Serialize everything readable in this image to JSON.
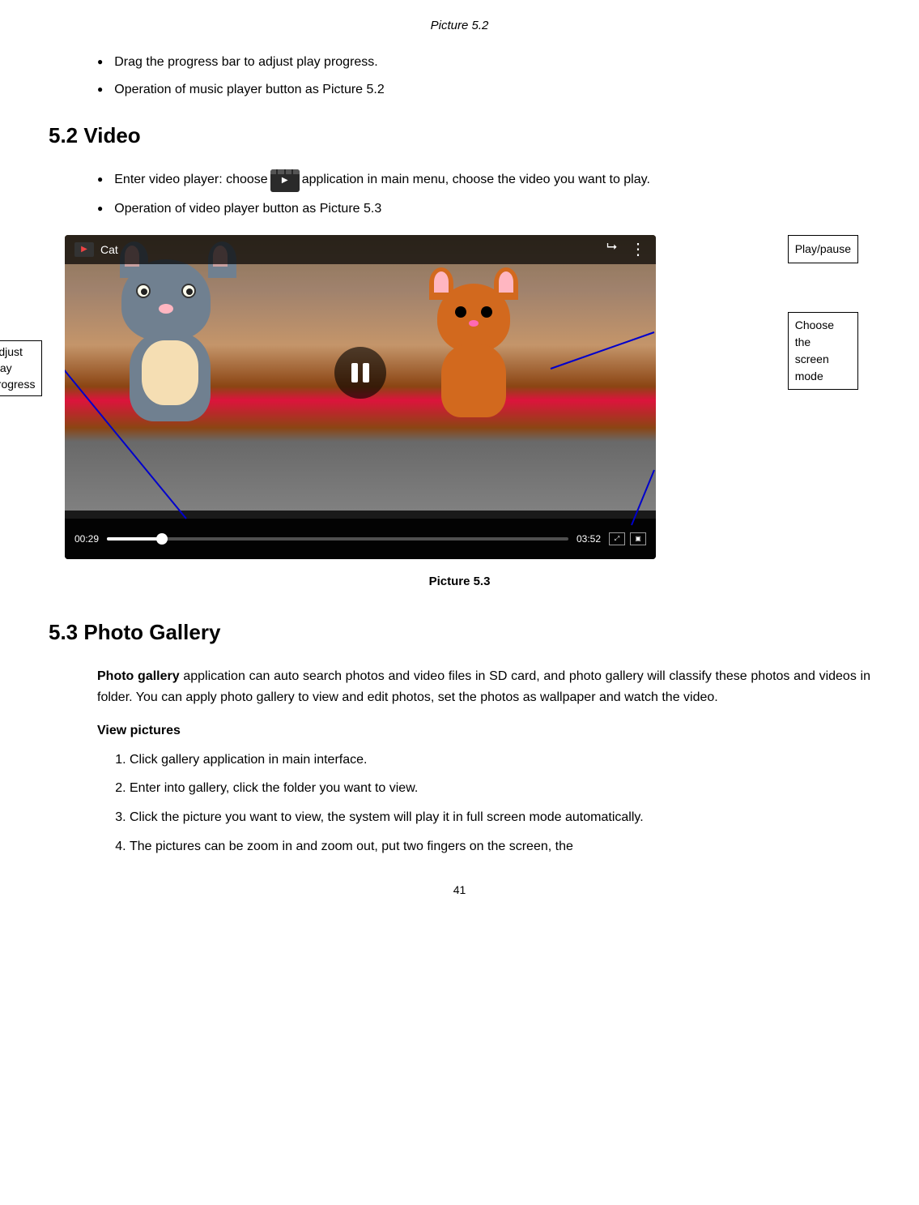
{
  "page": {
    "title": "Picture 5.2",
    "pageNumber": "41"
  },
  "section52": {
    "bullets": [
      "Drag the progress bar to adjust play progress.",
      "Operation of music player button as Picture 5.2"
    ]
  },
  "section52video": {
    "heading": "5.2 Video",
    "bullets": [
      "Enter video player: choose  application in main menu, choose the video you want to play.",
      "Operation of video player button as Picture 5.3"
    ],
    "videoTopBar": {
      "title": "Cat",
      "shareIcon": "⋮"
    },
    "videoControls": {
      "timeStart": "00:29",
      "timeEnd": "03:52"
    },
    "annotations": {
      "left": "Adjust\nplay\nprogress",
      "rightTop": "Play/pause",
      "rightBottom": "Choose\nthe\nscreen\nmode"
    },
    "caption": "Picture 5.3"
  },
  "section53": {
    "heading": "5.3 Photo Gallery",
    "intro": "Photo gallery application can auto search photos and video files in SD card, and photo gallery will classify these photos and videos in folder. You can apply photo gallery to view and edit photos, set the photos as wallpaper and watch the video.",
    "viewPicturesLabel": "View pictures",
    "steps": [
      "Click gallery application in main interface.",
      "Enter into gallery, click the folder you want to view.",
      "Click the picture you want to view, the system will play it in full screen mode automatically.",
      "The pictures can be zoom in and zoom out, put two fingers on the screen, the"
    ]
  }
}
